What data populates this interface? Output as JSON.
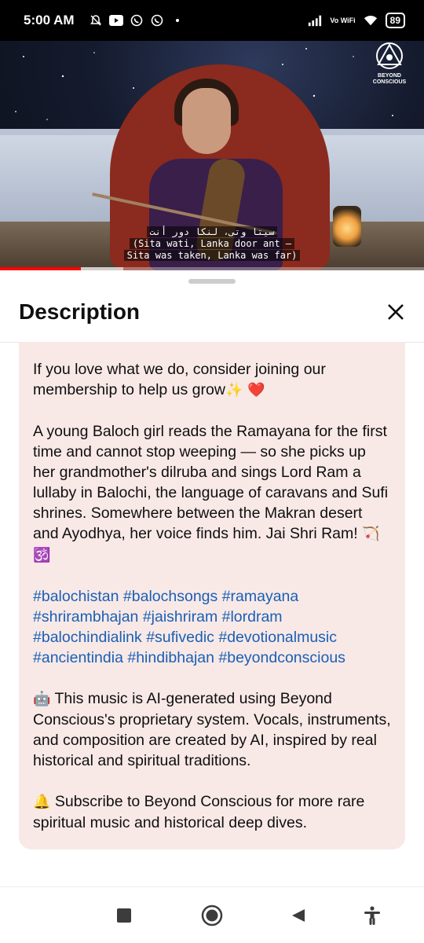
{
  "status_bar": {
    "time": "5:00 AM",
    "network_label": "Vo WiFi",
    "battery": "89",
    "icons": [
      "silent-bell-icon",
      "youtube-icon",
      "whatsapp-icon",
      "whatsapp-icon",
      "dot-icon",
      "signal-icon",
      "wifi-icon",
      "battery-icon"
    ]
  },
  "video": {
    "channel_logo_text": "BEYOND CONSCIOUS",
    "subtitle_line1": "سيتا وتى، لنكا دور أنت",
    "subtitle_line2": "(Sita wati, Lanka door ant —",
    "subtitle_line3": "Sita was taken, Lanka was far)",
    "progress_fraction": 0.19,
    "buffer_fraction": 0.29
  },
  "sheet": {
    "title": "Description",
    "close_icon": "close-icon"
  },
  "description": {
    "membership": "If you love what we do, consider joining our membership to help us grow",
    "membership_emoji": "✨ ❤️",
    "story": "A young Baloch girl reads the Ramayana for the first time and cannot stop weeping — so she picks up her grandmother's dilruba and sings Lord Ram a lullaby in Balochi, the language of caravans and Sufi shrines. Somewhere between the Makran desert and Ayodhya, her voice finds him. Jai Shri Ram!",
    "story_emoji": "🏹 🕉️",
    "hashtags": [
      "#balochistan",
      "#balochsongs",
      "#ramayana",
      "#shrirambhajan",
      "#jaishriram",
      "#lordram",
      "#balochindialink",
      "#sufivedic",
      "#devotionalmusic",
      "#ancientindia",
      "#hindibhajan",
      "#beyondconscious"
    ],
    "ai_emoji": "🤖",
    "ai_note": "This music is AI-generated using Beyond Conscious's proprietary system. Vocals, instruments, and composition are created by AI, inspired by real historical and spiritual traditions.",
    "subscribe_emoji": "🔔",
    "subscribe_note": "Subscribe to Beyond Conscious for more rare spiritual music and historical deep dives."
  },
  "nav_bar": {
    "icons": [
      "recents-square-icon",
      "home-circle-icon",
      "back-triangle-icon",
      "accessibility-icon"
    ]
  },
  "colors": {
    "accent_link": "#1a5fb4",
    "card_bg": "#f8e9e7",
    "progress": "#ff0000"
  }
}
